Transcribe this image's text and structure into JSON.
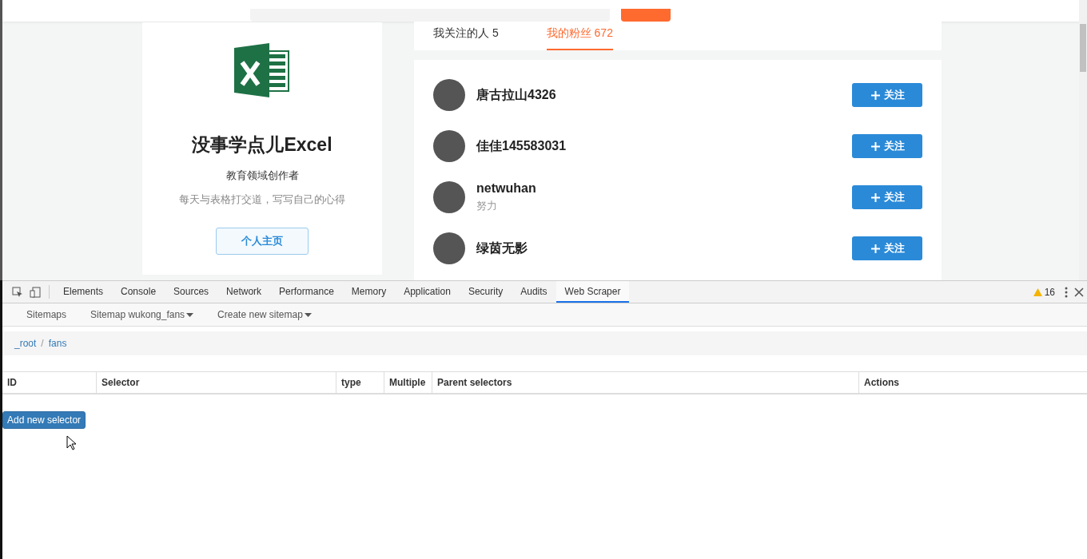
{
  "profile": {
    "name": "没事学点儿Excel",
    "role": "教育领域创作者",
    "motto": "每天与表格打交道，写写自己的心得",
    "home_button": "个人主页"
  },
  "tabs": [
    {
      "label": "我关注的人 5",
      "selected": false
    },
    {
      "label": "我的粉丝 672",
      "selected": true
    }
  ],
  "followers": [
    {
      "name": "唐古拉山4326",
      "follow": "关注"
    },
    {
      "name": "佳佳145583031",
      "follow": "关注"
    },
    {
      "name": "netwuhan",
      "bio": "努力",
      "follow": "关注"
    },
    {
      "name": "绿茵无影",
      "follow": "关注"
    }
  ],
  "devtools": {
    "tabs": [
      {
        "label": "Elements",
        "selected": false
      },
      {
        "label": "Console",
        "selected": false
      },
      {
        "label": "Sources",
        "selected": false
      },
      {
        "label": "Network",
        "selected": false
      },
      {
        "label": "Performance",
        "selected": false
      },
      {
        "label": "Memory",
        "selected": false
      },
      {
        "label": "Application",
        "selected": false
      },
      {
        "label": "Security",
        "selected": false
      },
      {
        "label": "Audits",
        "selected": false
      },
      {
        "label": "Web Scraper",
        "selected": true
      }
    ],
    "warnings": "16",
    "nav": [
      {
        "label": "Sitemaps",
        "dropdown": false
      },
      {
        "label": "Sitemap wukong_fans",
        "dropdown": true
      },
      {
        "label": "Create new sitemap",
        "dropdown": true
      }
    ],
    "breadcrumb": [
      "_root",
      "fans"
    ],
    "breadcrumb_separator": "/",
    "table": {
      "columns": [
        "ID",
        "Selector",
        "type",
        "Multiple",
        "Parent selectors",
        "Actions"
      ]
    },
    "add_button": "Add new selector"
  }
}
